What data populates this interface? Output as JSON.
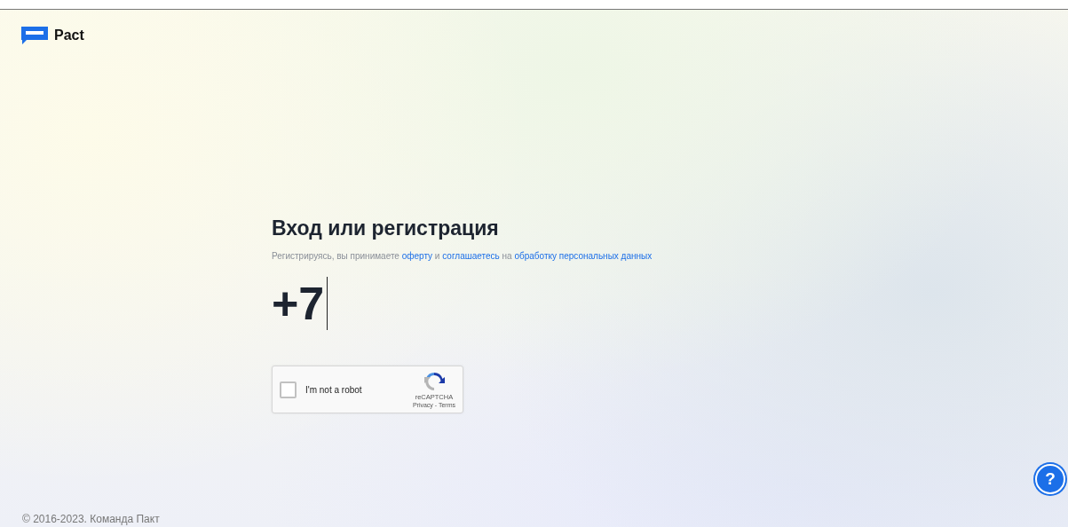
{
  "logo": {
    "text": "Pact"
  },
  "heading": "Вход или регистрация",
  "consent": [
    {
      "kind": "text",
      "text": "Регистрируясь, вы принимаете "
    },
    {
      "kind": "link",
      "text": "оферту"
    },
    {
      "kind": "text",
      "text": " и "
    },
    {
      "kind": "link",
      "text": "соглашаетесь"
    },
    {
      "kind": "text",
      "text": " на "
    },
    {
      "kind": "link",
      "text": "обработку персональных данных"
    }
  ],
  "phone": {
    "value": "+7"
  },
  "captcha": {
    "label": "I'm not a robot",
    "checked": false,
    "brand": "reCAPTCHA",
    "links": "Privacy - Terms"
  },
  "help_button": {
    "text": "?"
  },
  "footer": "© 2016-2023. Команда Пакт"
}
